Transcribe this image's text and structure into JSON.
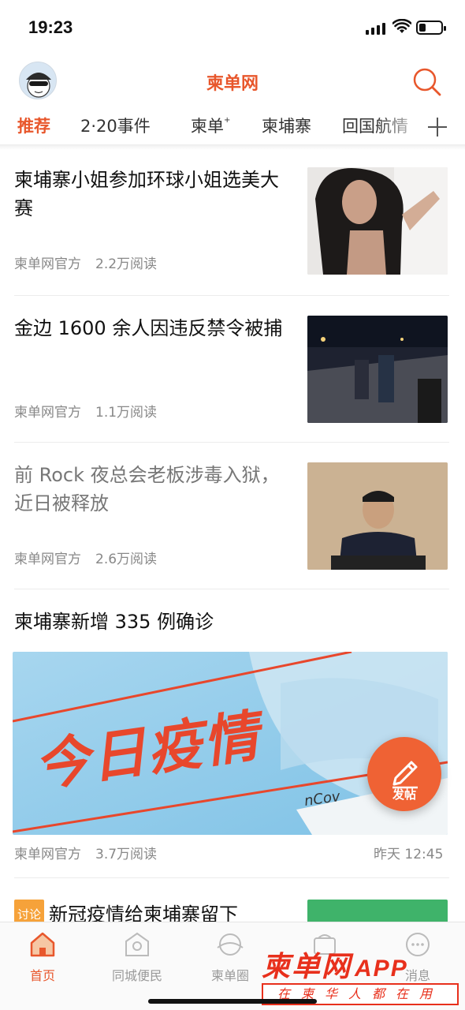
{
  "status_bar": {
    "time": "19:23"
  },
  "header": {
    "title": "柬单网"
  },
  "tabs": [
    {
      "label": "推荐",
      "active": true
    },
    {
      "label": "2·20事件"
    },
    {
      "label": "柬单",
      "sup": "+"
    },
    {
      "label": "柬埔寨"
    },
    {
      "label": "回国航情"
    }
  ],
  "feed": [
    {
      "title": "柬埔寨小姐参加环球小姐选美大赛",
      "source": "柬单网官方",
      "reads": "2.2万阅读"
    },
    {
      "title": "金边 1600 余人因违反禁令被捕",
      "source": "柬单网官方",
      "reads": "1.1万阅读"
    },
    {
      "title": "前 Rock 夜总会老板涉毒入狱，近日被释放",
      "source": "柬单网官方",
      "reads": "2.6万阅读"
    },
    {
      "title": "柬埔寨新增 335 例确诊",
      "source": "柬单网官方",
      "reads": "3.7万阅读",
      "time": "昨天 12:45",
      "banner_text": "今日疫情",
      "banner_note": "nCov"
    },
    {
      "tag": "讨论",
      "title": "新冠疫情给柬埔寨留下"
    }
  ],
  "fab": {
    "label": "发帖"
  },
  "bottom_nav": [
    {
      "label": "首页",
      "active": true,
      "icon": "home-icon"
    },
    {
      "label": "同城便民",
      "icon": "city-icon"
    },
    {
      "label": "柬单圈",
      "icon": "circle-icon"
    },
    {
      "label": "",
      "icon": "store-icon"
    },
    {
      "label": "消息",
      "icon": "message-icon"
    }
  ],
  "watermark": {
    "brand": "柬单网",
    "suffix": "APP",
    "slogan": "在柬华人都在用"
  },
  "colors": {
    "accent": "#e8572c",
    "brand_red": "#e8301c"
  }
}
